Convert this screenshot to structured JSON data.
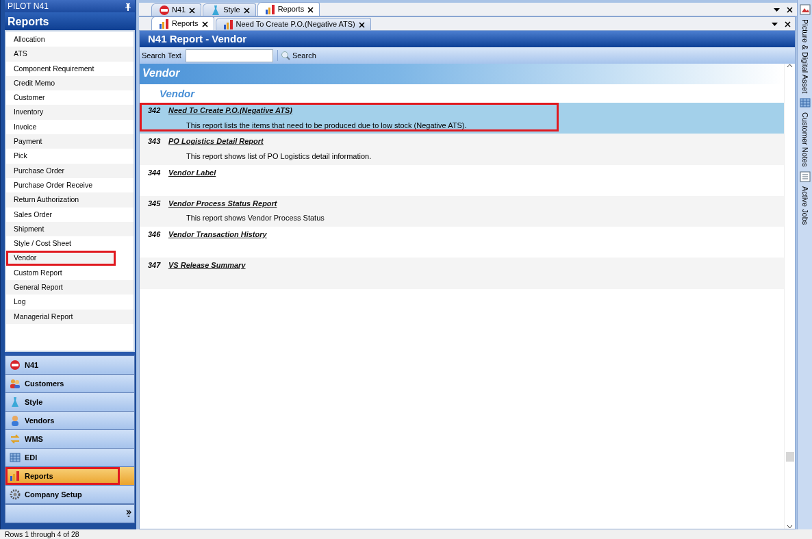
{
  "left_panel": {
    "title": "PILOT  N41",
    "section_title": "Reports",
    "items": [
      {
        "label": "Allocation",
        "highlighted": false
      },
      {
        "label": "ATS",
        "highlighted": false
      },
      {
        "label": "Component Requirement",
        "highlighted": false
      },
      {
        "label": "Credit Memo",
        "highlighted": false
      },
      {
        "label": "Customer",
        "highlighted": false
      },
      {
        "label": "Inventory",
        "highlighted": false
      },
      {
        "label": "Invoice",
        "highlighted": false
      },
      {
        "label": "Payment",
        "highlighted": false
      },
      {
        "label": "Pick",
        "highlighted": false
      },
      {
        "label": "Purchase Order",
        "highlighted": false
      },
      {
        "label": "Purchase Order Receive",
        "highlighted": false
      },
      {
        "label": "Return Authorization",
        "highlighted": false
      },
      {
        "label": "Sales Order",
        "highlighted": false
      },
      {
        "label": "Shipment",
        "highlighted": false
      },
      {
        "label": "Style / Cost Sheet",
        "highlighted": false
      },
      {
        "label": "Vendor",
        "highlighted": true
      },
      {
        "label": "Custom Report",
        "highlighted": false
      },
      {
        "label": "General Report",
        "highlighted": false
      },
      {
        "label": "Log",
        "highlighted": false
      },
      {
        "label": "Managerial Report",
        "highlighted": false
      }
    ],
    "nav": [
      {
        "label": "N41",
        "kind": "n41",
        "selected": false,
        "highlighted": false
      },
      {
        "label": "Customers",
        "kind": "people",
        "selected": false,
        "highlighted": false
      },
      {
        "label": "Style",
        "kind": "dress",
        "selected": false,
        "highlighted": false
      },
      {
        "label": "Vendors",
        "kind": "person",
        "selected": false,
        "highlighted": false
      },
      {
        "label": "WMS",
        "kind": "arrows",
        "selected": false,
        "highlighted": false
      },
      {
        "label": "EDI",
        "kind": "grid",
        "selected": false,
        "highlighted": false
      },
      {
        "label": "Reports",
        "kind": "chart",
        "selected": true,
        "highlighted": true
      },
      {
        "label": "Company Setup",
        "kind": "gear",
        "selected": false,
        "highlighted": false
      }
    ]
  },
  "tabs": [
    {
      "label": "N41",
      "kind": "n41",
      "selected": false
    },
    {
      "label": "Style",
      "kind": "dress",
      "selected": false
    },
    {
      "label": "Reports",
      "kind": "chart",
      "selected": true
    }
  ],
  "subtabs": [
    {
      "label": "Reports",
      "kind": "chart",
      "selected": true
    },
    {
      "label": "Need To Create P.O.(Negative ATS)",
      "kind": "chart",
      "selected": false
    }
  ],
  "report": {
    "title": "N41 Report - Vendor",
    "search_label": "Search Text",
    "search_button": "Search",
    "banner": "Vendor",
    "group": "Vendor",
    "rows": [
      {
        "number": "342",
        "name": "Need To Create P.O.(Negative ATS)",
        "description": "This report lists the items that need to be produced due to low stock (Negative ATS).",
        "selected": true,
        "highlighted": true
      },
      {
        "number": "343",
        "name": "PO Logistics Detail Report",
        "description": "This report shows list of PO Logistics detail information.",
        "selected": false,
        "highlighted": false
      },
      {
        "number": "344",
        "name": "Vendor Label",
        "selected": false,
        "highlighted": false
      },
      {
        "number": "345",
        "name": "Vendor Process Status Report",
        "description": "This report shows Vendor Process Status",
        "selected": false,
        "highlighted": false
      },
      {
        "number": "346",
        "name": "Vendor Transaction History",
        "selected": false,
        "highlighted": false
      },
      {
        "number": "347",
        "name": "VS Release Summary",
        "selected": false,
        "highlighted": false
      }
    ]
  },
  "right_strip": [
    {
      "label": "Picture & Digital Asset",
      "kind": "picture"
    },
    {
      "label": "Customer Notes",
      "kind": "grid"
    },
    {
      "label": "Active Jobs",
      "kind": "list"
    }
  ],
  "status_bar": "Rows 1 through 4 of 28"
}
